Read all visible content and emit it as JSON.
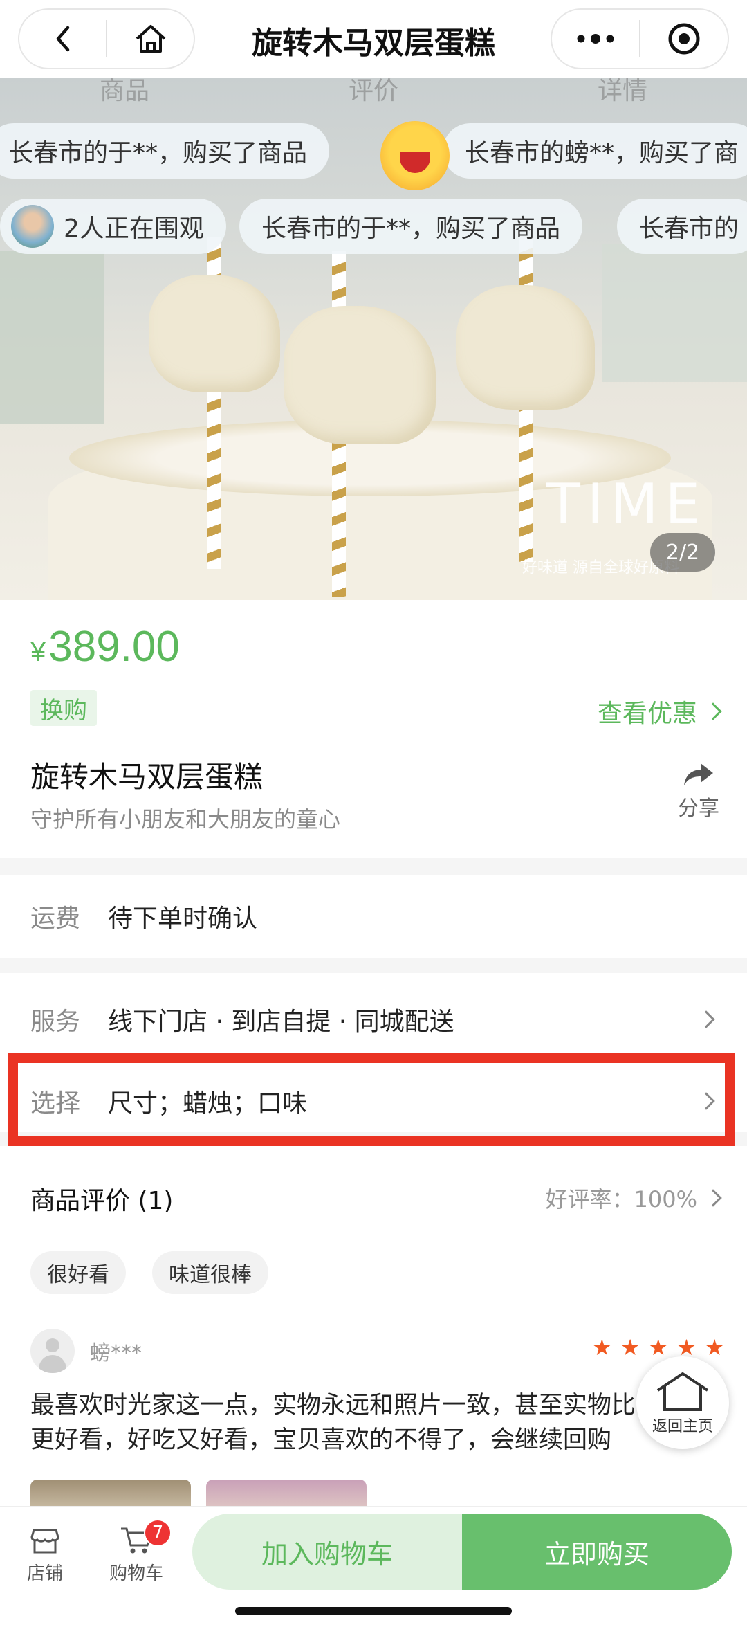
{
  "nav": {
    "title": "旋转木马双层蛋糕"
  },
  "hero": {
    "tabs": [
      "商品",
      "评价",
      "详情"
    ],
    "toasts": [
      "长春市的于**，购买了商品",
      "长春市的螃**，购买了商",
      "2人正在围观",
      "长春市的于**，购买了商品",
      "长春市的"
    ],
    "logo": "TIME",
    "logo_sub": "好味道  源自全球好原料",
    "page_indicator": "2/2"
  },
  "product": {
    "currency": "¥",
    "price": "389.00",
    "tag": "换购",
    "view_offers": "查看优惠",
    "name": "旋转木马双层蛋糕",
    "subtitle": "守护所有小朋友和大朋友的童心",
    "share_label": "分享"
  },
  "freight": {
    "label": "运费",
    "value": "待下单时确认"
  },
  "service": {
    "label": "服务",
    "value": "线下门店 · 到店自提 · 同城配送"
  },
  "select": {
    "label": "选择",
    "value": "尺寸；蜡烛；口味"
  },
  "reviews": {
    "title": "商品评价 (1)",
    "rate": "好评率：100%",
    "chips": [
      "很好看",
      "味道很棒"
    ],
    "user": "螃***",
    "stars": 5,
    "text_line1": "最喜欢时光家这一点，实物永远和照片一致，甚至实物比",
    "text_line2": "更好看，好吃又好看，宝贝喜欢的不得了，会继续回购"
  },
  "home_button": {
    "label": "返回主页"
  },
  "bottom": {
    "store_label": "店铺",
    "cart_label": "购物车",
    "cart_count": "7",
    "add_cart": "加入购物车",
    "buy_now": "立即购买"
  },
  "colors": {
    "accent": "#5cb85c",
    "buy": "#68bf6d",
    "highlight": "#ea3323",
    "star": "#f15a22"
  }
}
